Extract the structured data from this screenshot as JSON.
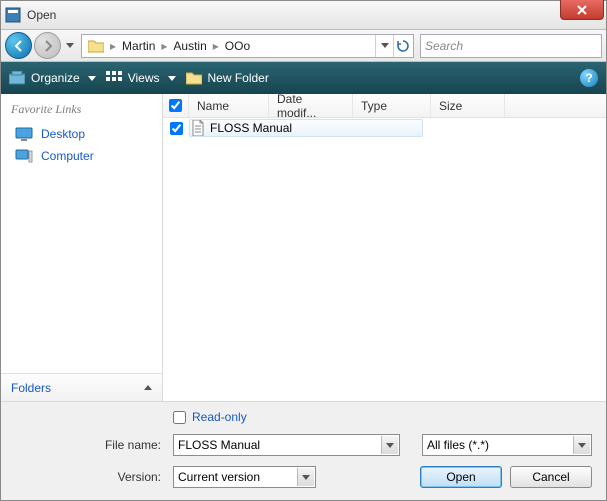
{
  "window": {
    "title": "Open"
  },
  "nav": {
    "crumbs": [
      "Martin",
      "Austin",
      "OOo"
    ],
    "search_placeholder": "Search"
  },
  "toolbar": {
    "organize": "Organize",
    "views": "Views",
    "new_folder": "New Folder"
  },
  "sidebar": {
    "favorites_header": "Favorite Links",
    "items": [
      {
        "label": "Desktop"
      },
      {
        "label": "Computer"
      }
    ],
    "folders": "Folders"
  },
  "columns": {
    "name": "Name",
    "date": "Date modif...",
    "type": "Type",
    "size": "Size"
  },
  "files": [
    {
      "name": "FLOSS Manual",
      "checked": true
    }
  ],
  "footer": {
    "readonly_label": "Read-only",
    "filename_label": "File name:",
    "filename_value": "FLOSS Manual",
    "filetype_value": "All files (*.*)",
    "version_label": "Version:",
    "version_value": "Current version",
    "open": "Open",
    "cancel": "Cancel"
  }
}
